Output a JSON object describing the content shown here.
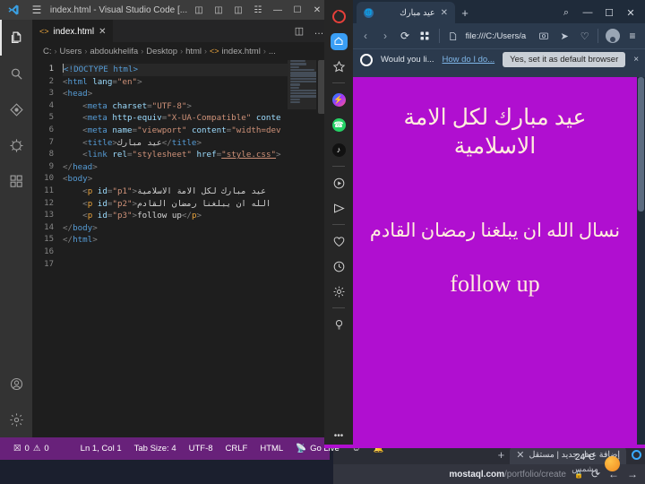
{
  "vscode": {
    "title": "index.html - Visual Studio Code [...",
    "window_buttons": {
      "minimize": "—",
      "maximize": "☐",
      "close": "✕"
    },
    "layout_icons": [
      "panel-left-icon",
      "panel-bottom-icon",
      "panel-right-icon",
      "layout-grid-icon"
    ],
    "activity_bar": [
      {
        "name": "explorer",
        "glyph": "❐"
      },
      {
        "name": "search",
        "glyph": "⌕"
      },
      {
        "name": "source-control",
        "glyph": "⎇"
      },
      {
        "name": "run-and-debug",
        "glyph": "⎈"
      },
      {
        "name": "extensions",
        "glyph": "⧉"
      }
    ],
    "activity_bar_bottom": [
      {
        "name": "accounts",
        "glyph": "○"
      },
      {
        "name": "manage-settings",
        "glyph": "⚙"
      }
    ],
    "tab": {
      "label": "index.html",
      "close": "✕",
      "icon": "html-file-icon"
    },
    "tab_actions": {
      "split_editor": "◫",
      "more_actions": "…"
    },
    "breadcrumb": [
      "C:",
      "Users",
      "abdoukhelifa",
      "Desktop",
      "html",
      "index.html",
      "..."
    ],
    "code_lines": [
      {
        "n": 1,
        "current": true,
        "html": "<span class=\"cursor\"></span><span class=\"tg\">&lt;!DOCTYPE html&gt;</span>"
      },
      {
        "n": 2,
        "current": false,
        "html": "<span class=\"pun\">&lt;</span><span class=\"tgn\">html</span> <span class=\"att\">lang</span><span class=\"pun\">=</span><span class=\"val\">\"en\"</span><span class=\"pun\">&gt;</span>"
      },
      {
        "n": 3,
        "current": false,
        "html": "<span class=\"pun\">&lt;</span><span class=\"tgn\">head</span><span class=\"pun\">&gt;</span>"
      },
      {
        "n": 4,
        "current": false,
        "html": "    <span class=\"pun\">&lt;</span><span class=\"tgn\">meta</span> <span class=\"att\">charset</span><span class=\"pun\">=</span><span class=\"val\">\"UTF-8\"</span><span class=\"pun\">&gt;</span>"
      },
      {
        "n": 5,
        "current": false,
        "html": "    <span class=\"pun\">&lt;</span><span class=\"tgn\">meta</span> <span class=\"att\">http-equiv</span><span class=\"pun\">=</span><span class=\"val\">\"X-UA-Compatible\"</span> <span class=\"att\">conte</span>"
      },
      {
        "n": 6,
        "current": false,
        "html": "    <span class=\"pun\">&lt;</span><span class=\"tgn\">meta</span> <span class=\"att\">name</span><span class=\"pun\">=</span><span class=\"val\">\"viewport\"</span> <span class=\"att\">content</span><span class=\"pun\">=</span><span class=\"val\">\"width=dev</span>"
      },
      {
        "n": 7,
        "current": false,
        "html": "    <span class=\"pun\">&lt;</span><span class=\"tgn\">title</span><span class=\"pun\">&gt;</span><span class=\"txt\">عيد مبارك</span><span class=\"pun\">&lt;/</span><span class=\"tgn\">title</span><span class=\"pun\">&gt;</span>"
      },
      {
        "n": 8,
        "current": false,
        "html": "    <span class=\"pun\">&lt;</span><span class=\"tgn\">link</span> <span class=\"att\">rel</span><span class=\"pun\">=</span><span class=\"val\">\"stylesheet\"</span> <span class=\"att\">href</span><span class=\"pun\">=</span><span class=\"lnk\">\"style.css\"</span><span class=\"pun\">&gt;</span>"
      },
      {
        "n": 9,
        "current": false,
        "html": "<span class=\"pun\">&lt;/</span><span class=\"tgn\">head</span><span class=\"pun\">&gt;</span>"
      },
      {
        "n": 10,
        "current": false,
        "html": "<span class=\"pun\">&lt;</span><span class=\"tgn\">body</span><span class=\"pun\">&gt;</span>"
      },
      {
        "n": 11,
        "current": false,
        "html": "    <span class=\"pun\">&lt;</span><span class=\"pb\">p</span> <span class=\"att\">id</span><span class=\"pun\">=</span><span class=\"val\">\"p1\"</span><span class=\"pun\">&gt;</span><span class=\"txt\">عيد مبارك لكل الامة الاسلامية</span>"
      },
      {
        "n": 12,
        "current": false,
        "html": "    <span class=\"pun\">&lt;</span><span class=\"pb\">p</span> <span class=\"att\">id</span><span class=\"pun\">=</span><span class=\"val\">\"p2\"</span><span class=\"pun\">&gt;</span><span class=\"txt\">الله ان يبلغنا رمضان القادم</span>"
      },
      {
        "n": 13,
        "current": false,
        "html": "    <span class=\"pun\">&lt;</span><span class=\"pb\">p</span> <span class=\"att\">id</span><span class=\"pun\">=</span><span class=\"val\">\"p3\"</span><span class=\"pun\">&gt;</span><span class=\"txt\">follow up</span><span class=\"pun\">&lt;/</span><span class=\"pb\">p</span><span class=\"pun\">&gt;</span>"
      },
      {
        "n": 14,
        "current": false,
        "html": "<span class=\"pun\">&lt;/</span><span class=\"tgn\">body</span><span class=\"pun\">&gt;</span>"
      },
      {
        "n": 15,
        "current": false,
        "html": "<span class=\"pun\">&lt;/</span><span class=\"tgn\">html</span><span class=\"pun\">&gt;</span>"
      },
      {
        "n": 16,
        "current": false,
        "html": ""
      },
      {
        "n": 17,
        "current": false,
        "html": ""
      }
    ],
    "status_bar": {
      "errors": "0",
      "warnings": "0",
      "cursor_position": "Ln 1, Col 1",
      "tab_size": "Tab Size: 4",
      "encoding": "UTF-8",
      "eol": "CRLF",
      "language": "HTML",
      "go_live": "Go Live",
      "feedback_icon": "smiley-icon",
      "bell_icon": "bell-icon"
    },
    "theme": {
      "status_bar_bg": "#68217a",
      "editor_bg": "#1e1e1e",
      "accent": "#569cd6"
    }
  },
  "opera": {
    "sidebar": [
      {
        "name": "opera-logo-icon",
        "glyph": "O"
      },
      {
        "name": "home-icon",
        "glyph": "⌂"
      },
      {
        "name": "pinboards-icon",
        "glyph": "⬠"
      },
      {
        "name": "messenger-icon",
        "glyph": "m"
      },
      {
        "name": "whatsapp-icon",
        "glyph": "✆"
      },
      {
        "name": "tiktok-icon",
        "glyph": "♪"
      },
      {
        "name": "player-icon",
        "glyph": "▶"
      },
      {
        "name": "telegram-icon",
        "glyph": "➤"
      },
      {
        "name": "favorites-icon",
        "glyph": "♡"
      },
      {
        "name": "history-icon",
        "glyph": "◴"
      },
      {
        "name": "settings-icon",
        "glyph": "⚙"
      },
      {
        "name": "tips-icon",
        "glyph": "☉"
      },
      {
        "name": "sidebar-more-icon",
        "glyph": "•••"
      }
    ],
    "tab": {
      "label": "عيد مبارك",
      "close": "✕"
    },
    "new_tab": "+",
    "window_buttons": {
      "search": "⌕",
      "minimize": "—",
      "maximize": "☐",
      "close": "✕"
    },
    "toolbar": {
      "back": "‹",
      "forward": "›",
      "reload": "⟳",
      "tab_islands": "∷",
      "page_icon": "page-icon",
      "url": "file:///C:/Users/a",
      "snapshot": "▣",
      "flow": "➤",
      "heart": "♡",
      "profile": "profile-avatar",
      "easy_setup": "≡"
    },
    "notification": {
      "text": "Would you li...",
      "link": "How do I do...",
      "button": "Yes, set it as default browser",
      "close": "×"
    },
    "page": {
      "background": "#b00fd0",
      "text_color": "#ffeedd",
      "p1": "عيد مبارك لكل الامة الاسلامية",
      "p2": "نسال الله ان يبلغنا رمضان القادم",
      "p3": "follow up"
    }
  },
  "background_browser": {
    "tab": {
      "label": "إضافة عمل جديد | مستقل",
      "close": "✕"
    },
    "new_tab": "+",
    "url_domain": "mostaql.com",
    "url_path": "/portfolio/create",
    "lock": "🔒",
    "reload": "⟳",
    "back": "←",
    "forward": "→"
  },
  "weather": {
    "temperature": "24°C",
    "condition": "مشمس",
    "icon": "sun-icon"
  }
}
